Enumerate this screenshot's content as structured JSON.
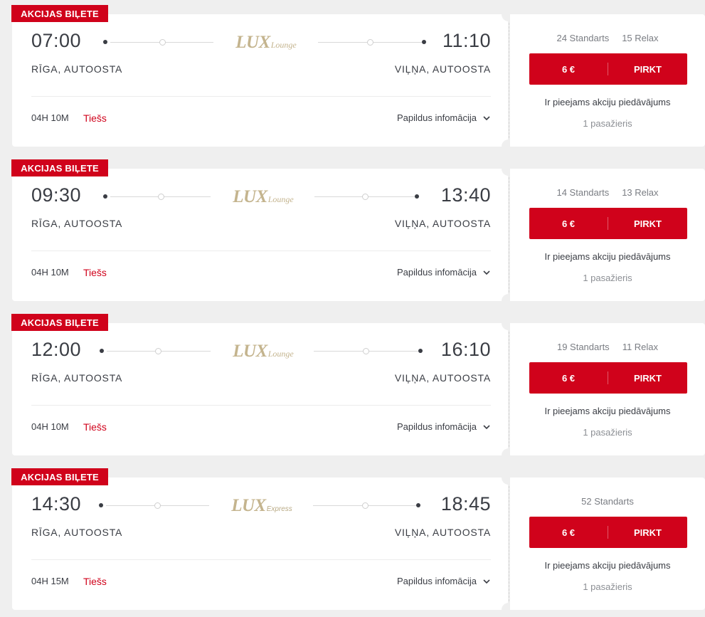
{
  "trips": [
    {
      "badge": "AKCIJAS BIĻETE",
      "departure_time": "07:00",
      "arrival_time": "11:10",
      "from": "RĪGA, AUTOOSTA",
      "to": "VIĻŅA, AUTOOSTA",
      "logo_brand": "LUX",
      "logo_sub": "Lounge",
      "duration": "04H 10M",
      "direct": "Tiešs",
      "more_info": "Papildus infomācija",
      "seats": [
        "24 Standarts",
        "15 Relax"
      ],
      "price": "6 €",
      "buy_label": "PIRKT",
      "promo": "Ir pieejams akciju piedāvājums",
      "passengers": "1 pasažieris"
    },
    {
      "badge": "AKCIJAS BIĻETE",
      "departure_time": "09:30",
      "arrival_time": "13:40",
      "from": "RĪGA, AUTOOSTA",
      "to": "VIĻŅA, AUTOOSTA",
      "logo_brand": "LUX",
      "logo_sub": "Lounge",
      "duration": "04H 10M",
      "direct": "Tiešs",
      "more_info": "Papildus infomācija",
      "seats": [
        "14 Standarts",
        "13 Relax"
      ],
      "price": "6 €",
      "buy_label": "PIRKT",
      "promo": "Ir pieejams akciju piedāvājums",
      "passengers": "1 pasažieris"
    },
    {
      "badge": "AKCIJAS BIĻETE",
      "departure_time": "12:00",
      "arrival_time": "16:10",
      "from": "RĪGA, AUTOOSTA",
      "to": "VIĻŅA, AUTOOSTA",
      "logo_brand": "LUX",
      "logo_sub": "Lounge",
      "duration": "04H 10M",
      "direct": "Tiešs",
      "more_info": "Papildus infomācija",
      "seats": [
        "19 Standarts",
        "11 Relax"
      ],
      "price": "6 €",
      "buy_label": "PIRKT",
      "promo": "Ir pieejams akciju piedāvājums",
      "passengers": "1 pasažieris"
    },
    {
      "badge": "AKCIJAS BIĻETE",
      "departure_time": "14:30",
      "arrival_time": "18:45",
      "from": "RĪGA, AUTOOSTA",
      "to": "VIĻŅA, AUTOOSTA",
      "logo_brand": "LUX",
      "logo_sub": "Express",
      "duration": "04H 15M",
      "direct": "Tiešs",
      "more_info": "Papildus infomācija",
      "seats": [
        "52 Standarts"
      ],
      "price": "6 €",
      "buy_label": "PIRKT",
      "promo": "Ir pieejams akciju piedāvājums",
      "passengers": "1 pasažieris"
    }
  ],
  "colors": {
    "accent": "#d0021b",
    "logo_gold": "#c4b48e",
    "background": "#efefef"
  },
  "icons": {
    "expand": "chevron-down-icon",
    "stop": "route-stop-icon"
  }
}
